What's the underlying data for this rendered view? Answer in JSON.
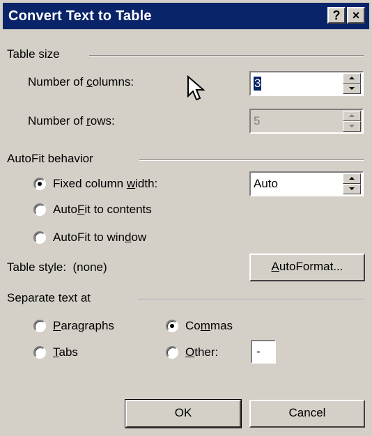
{
  "window": {
    "title": "Convert Text to Table",
    "help_button": "?",
    "close_button": "×"
  },
  "table_size": {
    "group_label": "Table size",
    "columns": {
      "label_pre": "Number of ",
      "label_ul": "c",
      "label_post": "olumns:",
      "value": "3"
    },
    "rows": {
      "label_pre": "Number of ",
      "label_ul": "r",
      "label_post": "ows:",
      "value": "5"
    }
  },
  "autofit": {
    "group_label": "AutoFit behavior",
    "options": [
      {
        "pre": "Fixed column ",
        "ul": "w",
        "post": "idth:",
        "selected": true
      },
      {
        "pre": "Auto",
        "ul": "F",
        "post": "it to contents",
        "selected": false
      },
      {
        "pre": "AutoFit to win",
        "ul": "d",
        "post": "ow",
        "selected": false
      }
    ],
    "fixed_width_value": "Auto"
  },
  "table_style": {
    "label": "Table style:",
    "value": "(none)",
    "autoformat_ul": "A",
    "autoformat_post": "utoFormat..."
  },
  "separate": {
    "group_label": "Separate text at",
    "paragraphs": {
      "ul": "P",
      "post": "aragraphs",
      "selected": false
    },
    "commas": {
      "pre": "Co",
      "ul": "m",
      "post": "mas",
      "selected": true
    },
    "tabs": {
      "ul": "T",
      "post": "abs",
      "selected": false
    },
    "other": {
      "ul": "O",
      "post": "ther:",
      "selected": false,
      "value": "-"
    }
  },
  "buttons": {
    "ok": "OK",
    "cancel": "Cancel"
  },
  "colors": {
    "face": "#d4d0c8",
    "title_bar": "#0a246a",
    "title_text": "#ffffff"
  }
}
